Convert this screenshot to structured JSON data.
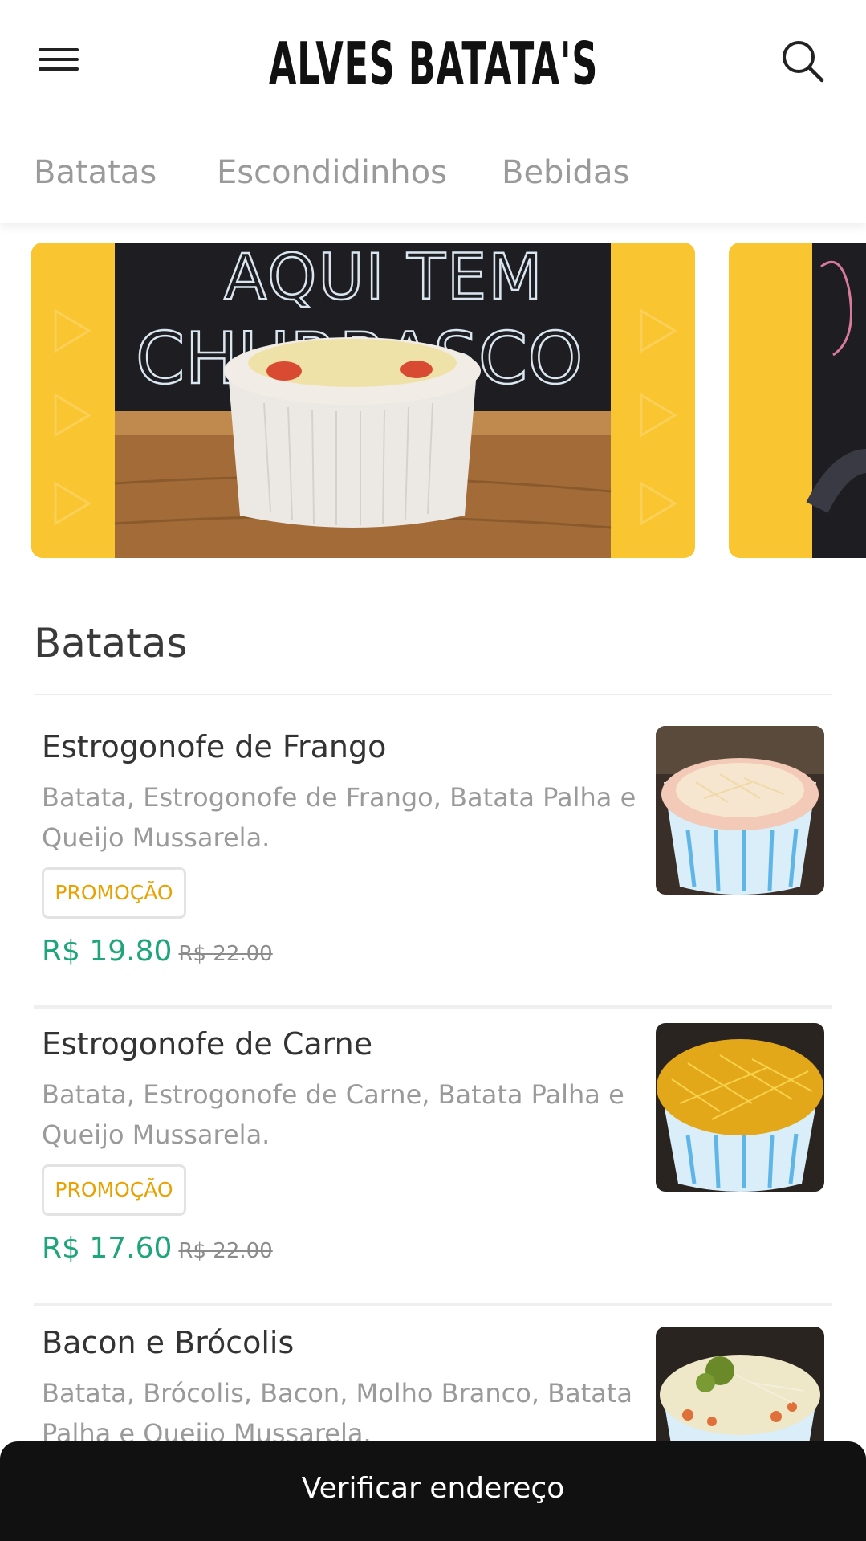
{
  "header": {
    "logo_text": "ALVES BATATA'S",
    "menu_icon": "hamburger-menu-icon",
    "search_icon": "search-icon"
  },
  "tabs": [
    {
      "label": "Batatas"
    },
    {
      "label": "Escondidinhos"
    },
    {
      "label": "Bebidas"
    }
  ],
  "banners": [
    {
      "image": "potato-bowl-photo-on-chalkboard-background",
      "chalk_text": "AQUI TEM CHURRASCO"
    },
    {
      "image": "partial-banner-photo"
    }
  ],
  "section": {
    "title": "Batatas",
    "items": [
      {
        "name": "Estrogonofe de Frango",
        "description": "Batata, Estrogonofe de Frango, Batata Palha e Queijo Mussarela.",
        "badge": "PROMOÇÃO",
        "price": "R$ 19.80",
        "old_price": "R$ 22.00",
        "image": "frango-potato-bowl-photo"
      },
      {
        "name": "Estrogonofe de Carne",
        "description": "Batata, Estrogonofe de Carne, Batata Palha e Queijo Mussarela.",
        "badge": "PROMOÇÃO",
        "price": "R$ 17.60",
        "old_price": "R$ 22.00",
        "image": "carne-potato-bowl-photo"
      },
      {
        "name": "Bacon e Brócolis",
        "description": "Batata, Brócolis, Bacon, Molho Branco, Batata Palha e Queijo Mussarela.",
        "image": "bacon-broccoli-potato-bowl-photo"
      }
    ]
  },
  "bottom_bar": {
    "label": "Verificar endereço"
  },
  "colors": {
    "price": "#1fa57a",
    "promo": "#e9a100",
    "banner_yellow": "#f9c531",
    "bottom_bar": "#111111"
  }
}
